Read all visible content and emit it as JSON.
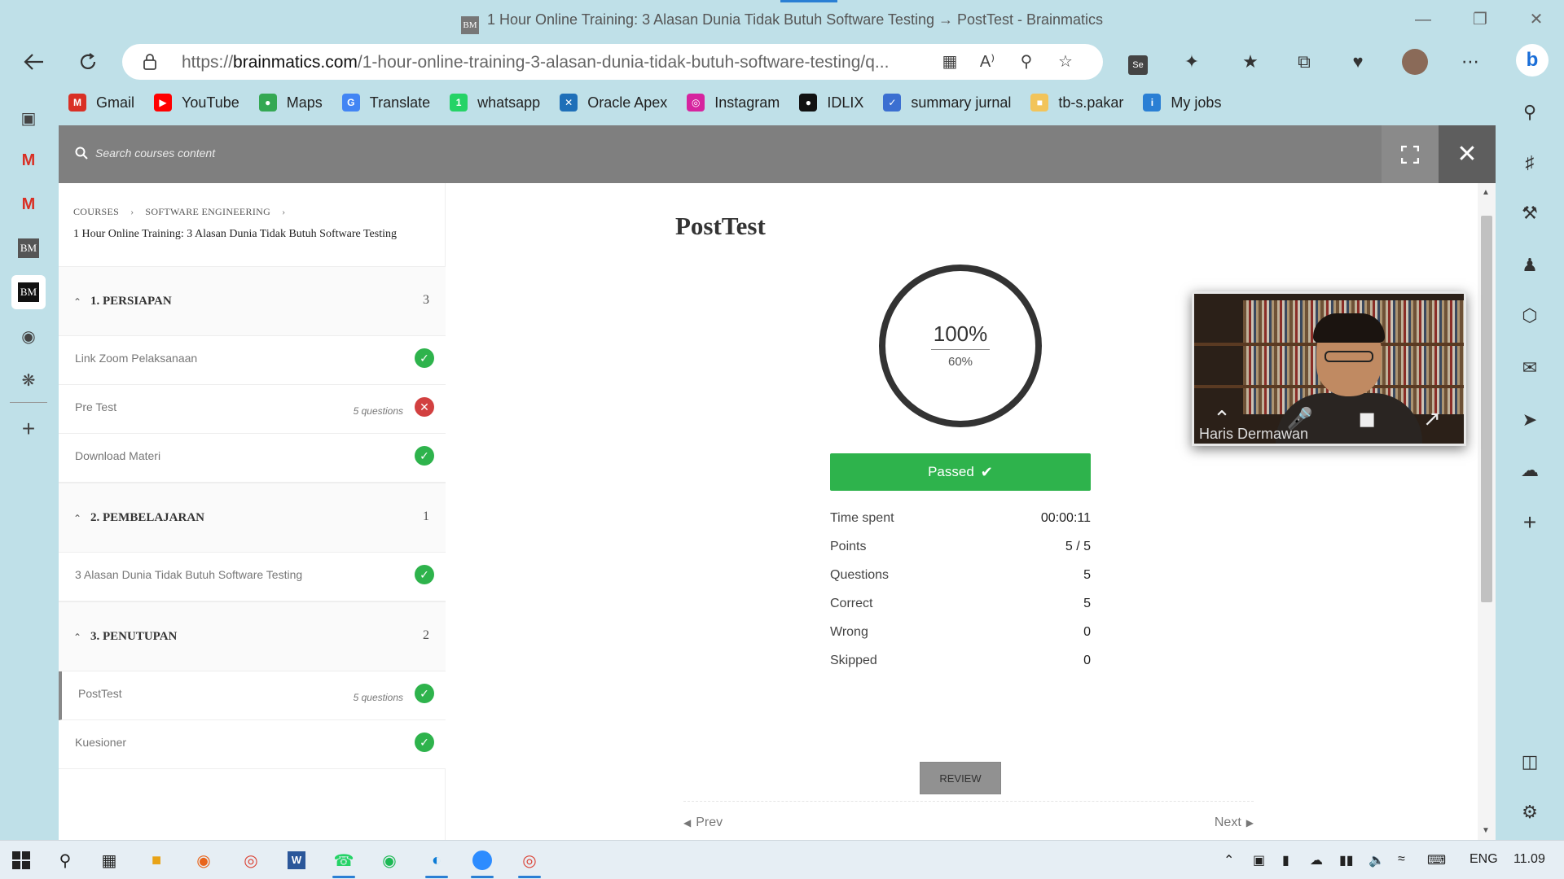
{
  "window": {
    "title": "1 Hour Online Training: 3 Alasan Dunia Tidak Butuh Software Testing → PostTest - Brainmatics",
    "favicon_text": "BM"
  },
  "address_bar": {
    "url_prefix": "https://",
    "url_domain": "brainmatics.com",
    "url_path": "/1-hour-online-training-3-alasan-dunia-tidak-butuh-software-testing/q...",
    "reading_mode_label": "A⁾"
  },
  "bookmarks": [
    {
      "label": "Gmail",
      "icon": "gmail-icon",
      "color": "#d93025",
      "glyph": "M"
    },
    {
      "label": "YouTube",
      "icon": "youtube-icon",
      "color": "#ff0000",
      "glyph": "▶"
    },
    {
      "label": "Maps",
      "icon": "maps-icon",
      "color": "#34a853",
      "glyph": "●"
    },
    {
      "label": "Translate",
      "icon": "translate-icon",
      "color": "#4285f4",
      "glyph": "G"
    },
    {
      "label": "whatsapp",
      "icon": "whatsapp-icon",
      "color": "#25d366",
      "glyph": "1"
    },
    {
      "label": "Oracle Apex",
      "icon": "oracle-apex-icon",
      "color": "#1f6fb8",
      "glyph": "✕"
    },
    {
      "label": "Instagram",
      "icon": "instagram-icon",
      "color": "#d6249f",
      "glyph": "◎"
    },
    {
      "label": "IDLIX",
      "icon": "idlix-icon",
      "color": "#111111",
      "glyph": "●"
    },
    {
      "label": "summary jurnal",
      "icon": "summary-jurnal-icon",
      "color": "#3b6fd1",
      "glyph": "✓"
    },
    {
      "label": "tb-s.pakar",
      "icon": "tb-spakar-icon",
      "color": "#f2c45a",
      "glyph": "■"
    },
    {
      "label": "My jobs",
      "icon": "my-jobs-icon",
      "color": "#2a7fd4",
      "glyph": "i"
    }
  ],
  "search": {
    "placeholder": "Search courses content"
  },
  "breadcrumb": {
    "item1": "COURSES",
    "item2": "SOFTWARE ENGINEERING"
  },
  "course": {
    "title": "1 Hour Online Training: 3 Alasan Dunia Tidak Butuh Software Testing"
  },
  "sections": [
    {
      "title": "1. PERSIAPAN",
      "count": "3",
      "lessons": [
        {
          "title": "Link Zoom Pelaksanaan",
          "meta": "",
          "status": "ok"
        },
        {
          "title": "Pre Test",
          "meta": "5 questions",
          "status": "fail"
        },
        {
          "title": "Download Materi",
          "meta": "",
          "status": "ok"
        }
      ]
    },
    {
      "title": "2. PEMBELAJARAN",
      "count": "1",
      "lessons": [
        {
          "title": "3 Alasan Dunia Tidak Butuh Software Testing",
          "meta": "",
          "status": "ok"
        }
      ]
    },
    {
      "title": "3. PENUTUPAN",
      "count": "2",
      "lessons": [
        {
          "title": "PostTest",
          "meta": "5 questions",
          "status": "ok"
        },
        {
          "title": "Kuesioner",
          "meta": "",
          "status": "ok"
        }
      ]
    }
  ],
  "quiz": {
    "title": "PostTest",
    "result_percent": "100%",
    "passing_percent": "60%",
    "status_label": "Passed",
    "stats": [
      {
        "label": "Time spent",
        "value": "00:00:11"
      },
      {
        "label": "Points",
        "value": "5 / 5"
      },
      {
        "label": "Questions",
        "value": "5"
      },
      {
        "label": "Correct",
        "value": "5"
      },
      {
        "label": "Wrong",
        "value": "0"
      },
      {
        "label": "Skipped",
        "value": "0"
      }
    ],
    "review_label": "REVIEW",
    "prev_label": "Prev",
    "next_label": "Next"
  },
  "video": {
    "participant_name": "Haris Dermawan"
  },
  "taskbar": {
    "language": "ENG",
    "time": "11.09"
  },
  "colors": {
    "success": "#2eb34c",
    "error": "#d24040",
    "chrome_bg": "#bfe0e8",
    "accent": "#2a7fd4"
  }
}
